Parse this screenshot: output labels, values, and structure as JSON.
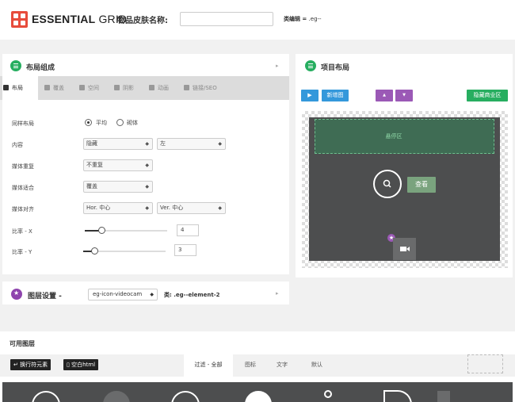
{
  "header": {
    "logo_bold": "ESSENTIAL",
    "logo_light": " GRID",
    "skin_name_label": "物品皮肤名称:",
    "skin_name_value": "",
    "class_label": "类编辑 =",
    "class_value": ".eg--"
  },
  "layout_panel": {
    "title": "布局组成",
    "tabs": [
      "布局",
      "覆盖",
      "空间",
      "阴影",
      "动画",
      "链接/SEO"
    ],
    "rows": {
      "same_layout": "同样布局",
      "content": "内容",
      "media_repeat": "媒体重复",
      "media_fit": "媒体适合",
      "media_align": "媒体对齐",
      "ratio_x": "比率 - X",
      "ratio_y": "比率 - Y"
    },
    "radio_options": [
      "平均",
      "砌体"
    ],
    "radio_selected": "平均",
    "content_select_1": "隐藏",
    "content_select_2": "左",
    "media_repeat_value": "不重复",
    "media_fit_value": "覆盖",
    "media_align_h": "Hor. 中心",
    "media_align_v": "Ver. 中心",
    "ratio_x_value": "4",
    "ratio_y_value": "3",
    "ratio_x_level": 0.2,
    "ratio_y_level": 0.13
  },
  "item_panel": {
    "title": "项目布局",
    "play_label": "▶",
    "new_image_label": "新增图",
    "up_label": "▲",
    "down_label": "▼",
    "hide_label": "隐藏商业区",
    "hover_zone_label": "悬停区",
    "view_label": "查看"
  },
  "layer_panel": {
    "title": "图层设置 -",
    "layer_value": "eg-icon-videocam",
    "class_label": "类:",
    "class_value": ".eg--element-2"
  },
  "available": {
    "title": "可用图层",
    "line_break_btn": "换行符元素",
    "blank_html_btn": "空白html",
    "filter_tabs": [
      "过滤 - 全部",
      "图标",
      "文字",
      "默认"
    ],
    "active_filter": "过滤 - 全部"
  },
  "colors": {
    "brand_red": "#e74c3c",
    "green": "#27ae60",
    "purple": "#9b59b6",
    "blue": "#3498db",
    "dark_preview": "#4d4e4f"
  }
}
